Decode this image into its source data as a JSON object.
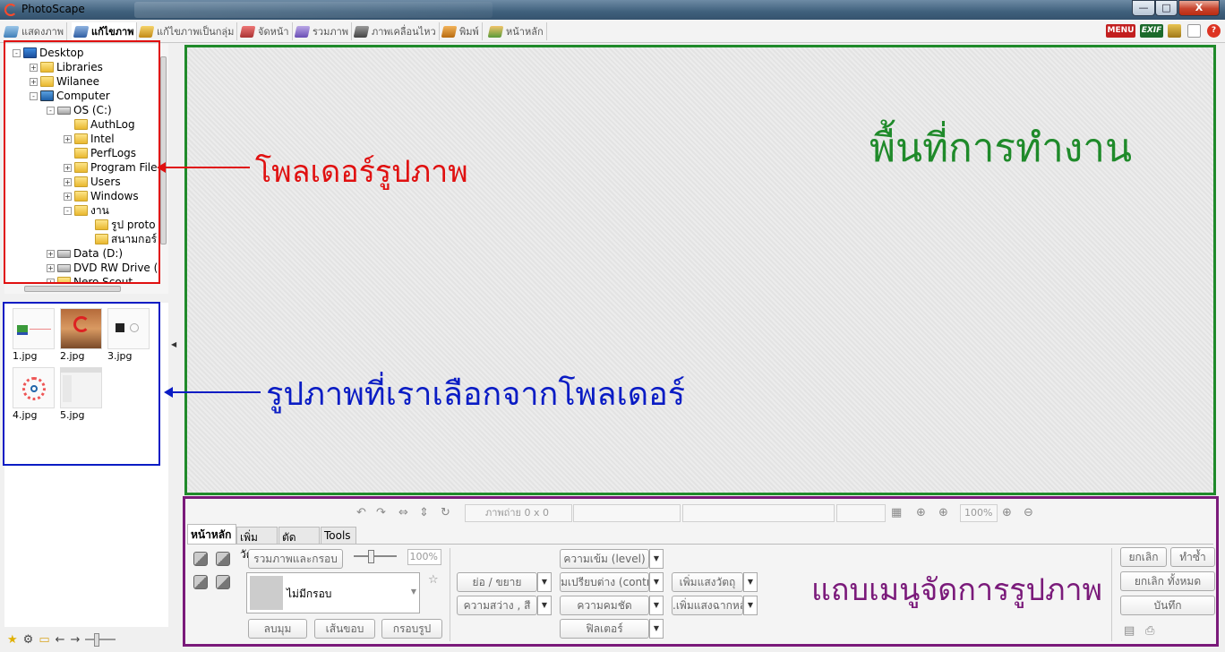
{
  "window": {
    "title": "PhotoScape",
    "controls": {
      "minimize": "—",
      "maximize": "□",
      "close": "X"
    }
  },
  "tabs": [
    {
      "label": "แสดงภาพ",
      "icon": "viewer-icon"
    },
    {
      "label": "แก้ไขภาพ",
      "icon": "editor-icon",
      "active": true
    },
    {
      "label": "แก้ไขภาพเป็นกลุ่ม",
      "icon": "batch-editor-icon"
    },
    {
      "label": "จัดหน้า",
      "icon": "page-icon"
    },
    {
      "label": "รวมภาพ",
      "icon": "combine-icon"
    },
    {
      "label": "ภาพเคลื่อนไหว",
      "icon": "animated-gif-icon"
    },
    {
      "label": "พิมพ์",
      "icon": "print-icon"
    },
    {
      "label": "หน้าหลัก",
      "icon": "home-icon"
    }
  ],
  "top_right_icons": {
    "menu": "MENU",
    "exif": "EXIF"
  },
  "tree": [
    {
      "label": "Desktop",
      "icon": "desktop",
      "exp": "-"
    },
    {
      "label": "Libraries",
      "icon": "folder",
      "exp": "+"
    },
    {
      "label": "Wilanee",
      "icon": "user-folder",
      "exp": "+"
    },
    {
      "label": "Computer",
      "icon": "computer",
      "exp": "-"
    },
    {
      "label": "OS (C:)",
      "icon": "drive",
      "exp": "-"
    },
    {
      "label": "AuthLog",
      "icon": "folder",
      "exp": ""
    },
    {
      "label": "Intel",
      "icon": "folder",
      "exp": "+"
    },
    {
      "label": "PerfLogs",
      "icon": "folder",
      "exp": ""
    },
    {
      "label": "Program File",
      "icon": "folder",
      "exp": "+"
    },
    {
      "label": "Users",
      "icon": "folder",
      "exp": "+"
    },
    {
      "label": "Windows",
      "icon": "folder",
      "exp": "+"
    },
    {
      "label": "งาน",
      "icon": "folder",
      "exp": "-"
    },
    {
      "label": "รูป proto",
      "icon": "folder",
      "exp": ""
    },
    {
      "label": "สนามกอร์",
      "icon": "folder",
      "exp": ""
    },
    {
      "label": "Data (D:)",
      "icon": "drive",
      "exp": "+"
    },
    {
      "label": "DVD RW Drive (",
      "icon": "dvd",
      "exp": "+"
    },
    {
      "label": "Nero Scout",
      "icon": "folder",
      "exp": "+"
    }
  ],
  "thumbnails": [
    "1.jpg",
    "2.jpg",
    "3.jpg",
    "4.jpg",
    "5.jpg"
  ],
  "workspace": {},
  "panel": {
    "status": {
      "photo_info": "ภาพถ่าย 0 x 0",
      "zoom": "100%"
    },
    "tabs": [
      "หน้าหลัก",
      "เพิ่มวัตถุ",
      "ตัดภาพ",
      "Tools"
    ],
    "frame_button": "รวมภาพและกรอบ",
    "frame_pct": "100%",
    "frame_selected": "ไม่มีกรอบ",
    "round_button": "ลบมุม",
    "border_button": "เส้นขอบ",
    "frame_image_button": "กรอบรูป",
    "resize": "ย่อ / ขยาย",
    "brightness": "ความสว่าง , สี",
    "level": "ความเข้ม (level)",
    "contrast": "มเปรียบต่าง (contr",
    "sharpen": "ความคมชัด",
    "filter": "ฟิลเตอร์",
    "bloom_object": "เพิ่มแสงวัตถุ",
    "bloom_bg": ".เพิ่มแสงฉากหลัง",
    "cancel": "ยกเลิก",
    "redo": "ทำซ้ำ",
    "cancel_all": "ยกเลิก ทั้งหมด",
    "save": "บันทึก"
  },
  "annotations": {
    "folder": "โพลเดอร์รูปภาพ",
    "thumbs": "รูปภาพที่เราเลือกจากโพลเดอร์",
    "workspace": "พื้นที่การทำงาน",
    "menu": "แถบเมนูจัดการรูปภาพ",
    "colors": {
      "red": "#e01010",
      "blue": "#0a1cc4",
      "green": "#1f8a2a",
      "purple": "#7a1a7a"
    }
  }
}
